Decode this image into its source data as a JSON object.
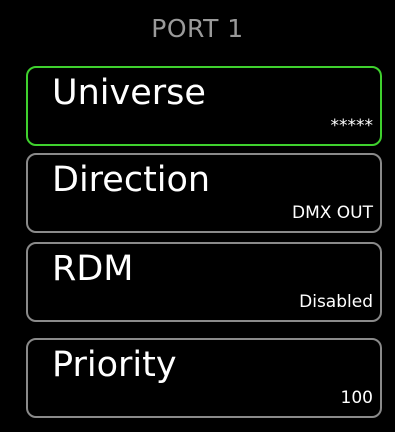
{
  "header": {
    "title": "PORT 1"
  },
  "menu": {
    "items": [
      {
        "label": "Universe",
        "value": "*****",
        "selected": true
      },
      {
        "label": "Direction",
        "value": "DMX OUT",
        "selected": false
      },
      {
        "label": "RDM",
        "value": "Disabled",
        "selected": false
      },
      {
        "label": "Priority",
        "value": "100",
        "selected": false
      }
    ]
  },
  "colors": {
    "background": "#000000",
    "title": "#9a9a9a",
    "card_border": "#8a8a8a",
    "selected_border": "#3fd12e",
    "text": "#ffffff"
  }
}
